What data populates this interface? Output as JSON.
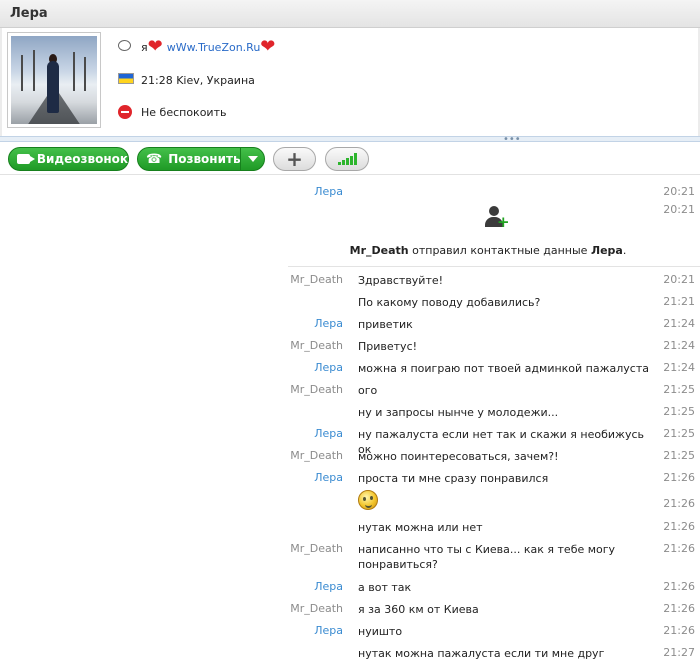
{
  "window": {
    "title": "Лера"
  },
  "profile": {
    "mood": {
      "prefix": "я",
      "link": "wWw.TrueZon.Ru"
    },
    "location": "21:28 Kiev, Украина",
    "status": "Не беспокоить"
  },
  "toolbar": {
    "video_call": "Видеозвонок",
    "call": "Позвонить"
  },
  "chat": {
    "first": {
      "sender": "Лера",
      "time": "20:21"
    },
    "contact_share": {
      "time": "20:21",
      "from": "Mr_Death",
      "verb": "отправил контактные данные",
      "contact": "Лера",
      "end": "."
    },
    "messages": [
      {
        "sender": "Mr_Death",
        "text": "Здравствуйте!",
        "time": "20:21"
      },
      {
        "sender": "",
        "text": "По какому поводу добавились?",
        "time": "21:21"
      },
      {
        "sender": "Лера",
        "text": "приветик",
        "time": "21:24"
      },
      {
        "sender": "Mr_Death",
        "text": "Приветус!",
        "time": "21:24"
      },
      {
        "sender": "Лера",
        "text": "можна я поиграю пот твоей админкой пажалуста",
        "time": "21:24"
      },
      {
        "sender": "Mr_Death",
        "text": "ого",
        "time": "21:25"
      },
      {
        "sender": "",
        "text": "ну и запросы нынче у молодежи...",
        "time": "21:25"
      },
      {
        "sender": "Лера",
        "text": "ну пажалуста если нет так и скажи я необижусь ок",
        "time": "21:25"
      },
      {
        "sender": "Mr_Death",
        "text": "можно поинтересоваться, зачем?!",
        "time": "21:25"
      },
      {
        "sender": "Лера",
        "text": "проста ти мне сразу понравился",
        "time": "21:26"
      },
      {
        "sender": "",
        "text": "",
        "time": "21:26",
        "emoticon": "blush-smiley"
      },
      {
        "sender": "",
        "text": "нутак можна или нет",
        "time": "21:26"
      },
      {
        "sender": "Mr_Death",
        "text": "написанно что ты с Киева... как я тебе могу понравиться?",
        "time": "21:26"
      },
      {
        "sender": "Лера",
        "text": "а вот так",
        "time": "21:26"
      },
      {
        "sender": "Mr_Death",
        "text": "я за 360 км от Киева",
        "time": "21:26"
      },
      {
        "sender": "Лера",
        "text": "нуишто",
        "time": "21:26"
      },
      {
        "sender": "",
        "text": "нутак можна пажалуста если ти мне друг",
        "time": "21:27"
      }
    ]
  },
  "colors": {
    "accent_green": "#1f9a26",
    "lera_name": "#3a8bd1",
    "other_name": "#8c8c8c",
    "heart": "#e0252b"
  }
}
